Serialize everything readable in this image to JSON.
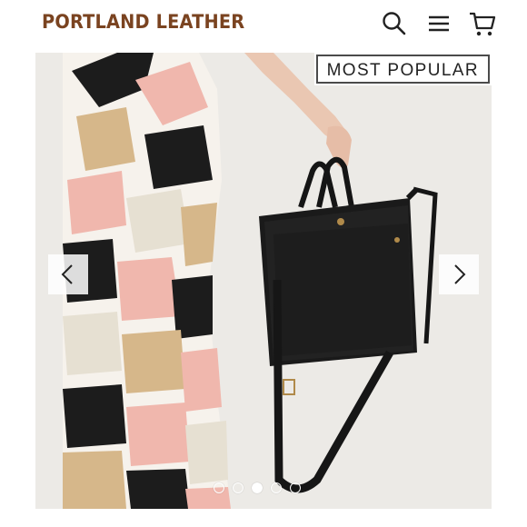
{
  "header": {
    "brand": "PORTLAND LEATHER",
    "icons": {
      "search": "search-icon",
      "menu": "menu-icon",
      "cart": "cart-icon"
    }
  },
  "hero": {
    "badge": "MOST POPULAR",
    "image": "model-with-black-leather-tote",
    "slides": 5,
    "active_slide": 3,
    "prev_icon": "chevron-left-icon",
    "next_icon": "chevron-right-icon"
  },
  "colors": {
    "brand": "#7a4320",
    "badge_border": "#4a4a4a"
  }
}
